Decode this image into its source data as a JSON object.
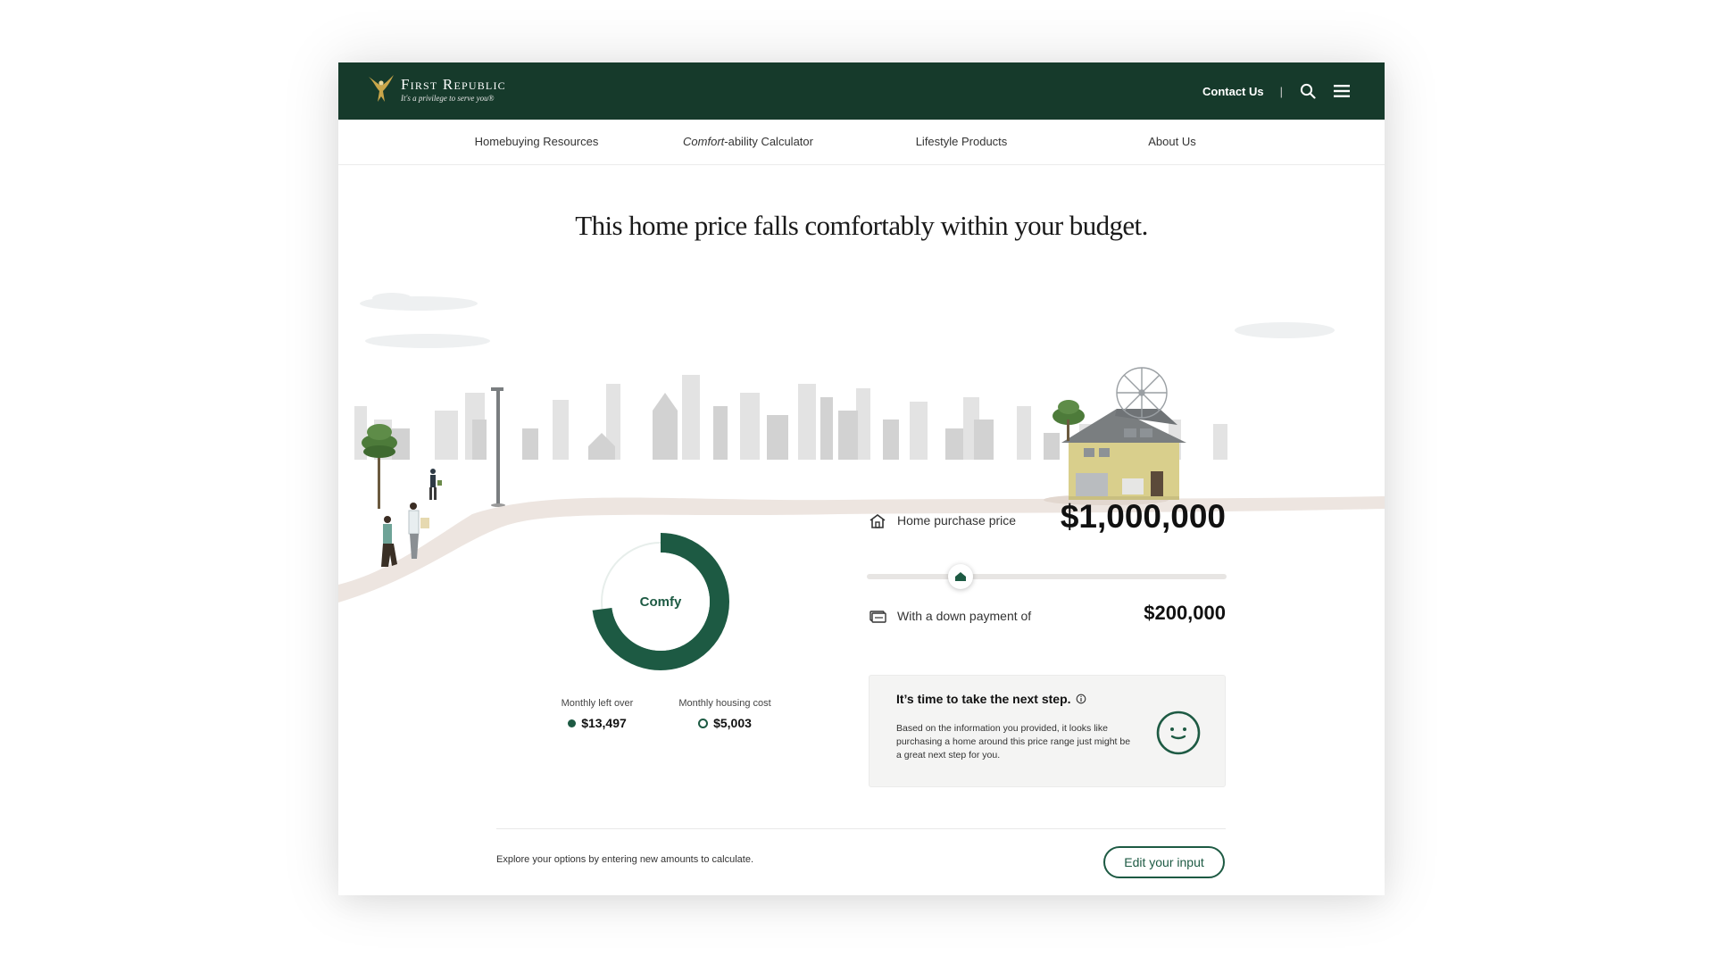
{
  "header": {
    "brand_name": "First Republic",
    "tagline": "It's a privilege to serve you®",
    "contact_label": "Contact Us",
    "separator": "|"
  },
  "nav": {
    "items": [
      {
        "label": "Homebuying Resources"
      },
      {
        "label_italic": "Comfort",
        "label_rest": "-ability Calculator"
      },
      {
        "label": "Lifestyle Products"
      },
      {
        "label": "About Us"
      }
    ]
  },
  "headline": "This home price falls comfortably within your budget.",
  "comfort": {
    "status": "Comfy",
    "left_over_label": "Monthly left over",
    "left_over_value": "$13,497",
    "housing_cost_label": "Monthly housing cost",
    "housing_cost_value": "$5,003",
    "ring_color": "#1d5a43"
  },
  "price": {
    "label": "Home purchase price",
    "value": "$1,000,000",
    "slider_fraction": 0.25
  },
  "down_payment": {
    "label": "With a down payment of",
    "value": "$200,000"
  },
  "next_step": {
    "title": "It’s time to take the next step.",
    "body": "Based on the information you provided, it looks like purchasing a home around this price range just might be a great next step for you."
  },
  "footer": {
    "explore_text": "Explore your options by entering new amounts to calculate.",
    "edit_button": "Edit your input"
  },
  "colors": {
    "brand_dark": "#163a2b",
    "accent_green": "#1d5a43"
  }
}
